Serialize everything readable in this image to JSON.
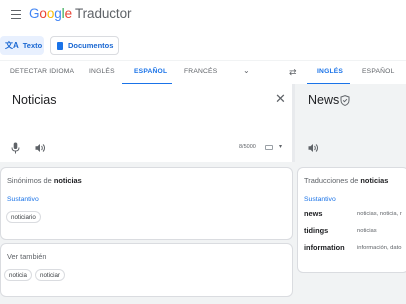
{
  "header": {
    "logo": {
      "G": "G",
      "o1": "o",
      "o2": "o",
      "g": "g",
      "l": "l",
      "e": "e"
    },
    "product": "Traductor"
  },
  "modes": {
    "text": {
      "label": "Texto"
    },
    "documents": {
      "label": "Documentos"
    }
  },
  "source_langs": {
    "detect": "DETECTAR IDIOMA",
    "english": "INGLÉS",
    "spanish": "ESPAÑOL",
    "french": "FRANCÉS"
  },
  "target_langs": {
    "english": "INGLÉS",
    "spanish": "ESPAÑOL"
  },
  "source": {
    "text": "Noticias",
    "char_count": "8/5000"
  },
  "target": {
    "text": "News"
  },
  "synonyms": {
    "title_prefix": "Sinónimos de ",
    "title_word": "noticias",
    "pos": "Sustantivo",
    "chips": [
      "noticiario"
    ]
  },
  "see_also": {
    "title": "Ver también",
    "chips": [
      "noticia",
      "noticiar"
    ]
  },
  "translations": {
    "title_prefix": "Traducciones de ",
    "title_word": "noticias",
    "pos": "Sustantivo",
    "rows": [
      {
        "word": "news",
        "syn": "noticias, noticia, r"
      },
      {
        "word": "tidings",
        "syn": "noticias"
      },
      {
        "word": "information",
        "syn": "información, dato"
      }
    ]
  },
  "colors": {
    "accent": "#1a73e8",
    "chip_bg": "#e8f0fe"
  }
}
